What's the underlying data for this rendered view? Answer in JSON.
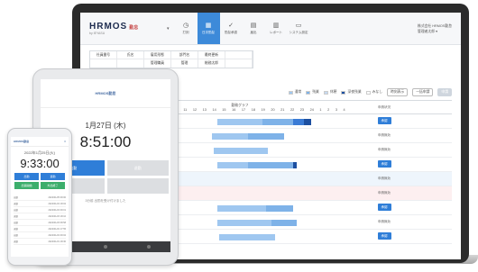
{
  "laptop": {
    "brand": {
      "logo": "HRMOS",
      "logo_suffix": "勤怠",
      "sub": "by IEYASU"
    },
    "nav": [
      {
        "label": "打刻",
        "icon": "clock-icon",
        "glyph": "◷"
      },
      {
        "label": "日次勤怠",
        "icon": "calendar-icon",
        "glyph": "▦",
        "active": true
      },
      {
        "label": "勤怠承認",
        "icon": "check-icon",
        "glyph": "✓"
      },
      {
        "label": "届出",
        "icon": "document-icon",
        "glyph": "▤"
      },
      {
        "label": "レポート",
        "icon": "report-icon",
        "glyph": "▥"
      },
      {
        "label": "システム設定",
        "icon": "monitor-icon",
        "glyph": "▭"
      }
    ],
    "user": {
      "line1": "株式会社 HRMOS勤怠",
      "line2": "管理者太郎 ▾"
    },
    "info_grid": {
      "headers": [
        "社員番号",
        "氏名",
        "雇用形態",
        "部門名",
        "最終更新"
      ],
      "values": [
        "",
        "",
        "",
        "",
        ""
      ]
    },
    "info_grid_cells": [
      "社員番号",
      "氏名",
      "雇用形態",
      "部門名",
      "最終更新",
      "",
      "",
      "",
      "管理職員",
      "管理",
      "総務太郎",
      ""
    ],
    "filters": {
      "legend": [
        {
          "label": "通常",
          "color": "#9fc7f0"
        },
        {
          "label": "残業",
          "color": "#7eb2e8"
        },
        {
          "label": "休憩",
          "color": "#c6d9ef"
        },
        {
          "label": "深夜残業",
          "color": "#1c4fa0"
        },
        {
          "label": "みなし",
          "color": "#ffffff"
        }
      ],
      "time_button": "時刻表示",
      "bulk_button": "一括申請",
      "solid_button": "申請"
    },
    "table": {
      "headers": {
        "day": "日付",
        "worked": "勤務時間",
        "total": "実勤務時間",
        "chart": "勤務グラフ",
        "action": "申請状況"
      },
      "hours": [
        "5",
        "6",
        "7",
        "8",
        "9",
        "10",
        "11",
        "12",
        "13",
        "14",
        "15",
        "16",
        "17",
        "18",
        "19",
        "20",
        "21",
        "22",
        "23",
        "24",
        "1",
        "2",
        "3",
        "4"
      ],
      "rows": [
        {
          "day": "14",
          "a": "1:00",
          "b": "5:34",
          "type": "normal",
          "action": "承認"
        },
        {
          "day": "15",
          "a": "1:00",
          "b": "3:49",
          "type": "normal",
          "action": "申請無効"
        },
        {
          "day": "16",
          "a": "1:00",
          "b": "2:15",
          "type": "normal",
          "action": "申請無効"
        },
        {
          "day": "17",
          "a": "1:00",
          "b": "4:59",
          "type": "normal",
          "action": "承認"
        },
        {
          "day": "18",
          "a": "0:00",
          "b": "0:00",
          "type": "blue",
          "action": "申請無効"
        },
        {
          "day": "19",
          "a": "0:00",
          "b": "0:00",
          "type": "red",
          "action": "申請無効"
        },
        {
          "day": "20",
          "a": "1:00",
          "b": "4:28",
          "type": "normal",
          "action": "承認"
        },
        {
          "day": "21",
          "a": "1:00",
          "b": "4:02",
          "type": "normal",
          "action": "申請無効"
        },
        {
          "day": "22",
          "a": "1:00",
          "b": "2:45",
          "type": "normal",
          "action": "承認"
        }
      ]
    }
  },
  "tablet": {
    "header": "HRMOS勤怠",
    "date": "1月27日 (木)",
    "time": "8:51:00",
    "buttons": [
      "出勤",
      "退勤",
      "",
      ""
    ],
    "note": "3分前 出勤を受け付けました"
  },
  "phone": {
    "header": "HRMOS勤怠",
    "date": "2022年1月25日(火)",
    "time": "9:33:00",
    "buttons": [
      "出勤",
      "退勤",
      "出張開始",
      "外出終了"
    ],
    "list": [
      {
        "left": "出勤",
        "right": "2022/01/25 09:00"
      },
      {
        "left": "退勤",
        "right": "2022/01/24 18:02"
      },
      {
        "left": "出勤",
        "right": "2022/01/24 09:01"
      },
      {
        "left": "退勤",
        "right": "2022/01/23 18:10"
      },
      {
        "left": "出勤",
        "right": "2022/01/23 08:58"
      },
      {
        "left": "退勤",
        "right": "2022/01/22 17:55"
      },
      {
        "left": "出勤",
        "right": "2022/01/22 09:02"
      },
      {
        "left": "退勤",
        "right": "2022/01/21 18:30"
      }
    ]
  }
}
